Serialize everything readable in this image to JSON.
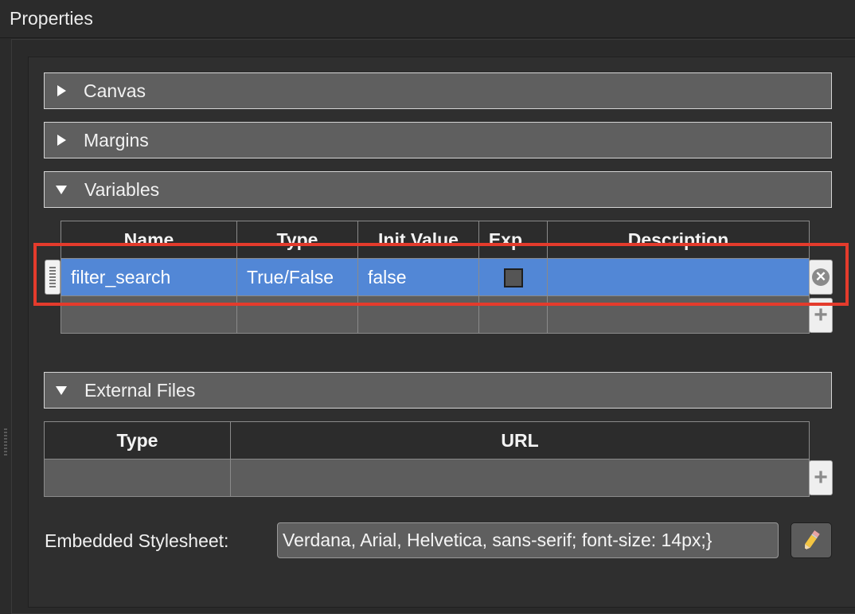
{
  "panel": {
    "title": "Properties"
  },
  "sections": [
    {
      "label": "Canvas",
      "expanded": false
    },
    {
      "label": "Margins",
      "expanded": false
    },
    {
      "label": "Variables",
      "expanded": true
    },
    {
      "label": "External Files",
      "expanded": true
    }
  ],
  "variables": {
    "headers": [
      "Name",
      "Type",
      "Init Value",
      "Exp...",
      "Description"
    ],
    "rows": [
      {
        "name": "filter_search",
        "type": "True/False",
        "init_value": "false",
        "exported": false,
        "description": "",
        "selected": true
      },
      {
        "name": "",
        "type": "",
        "init_value": "",
        "exported": null,
        "description": "",
        "selected": false
      }
    ]
  },
  "external_files": {
    "headers": [
      "Type",
      "URL"
    ],
    "rows": [
      {
        "type": "",
        "url": ""
      }
    ]
  },
  "stylesheet": {
    "label": "Embedded Stylesheet:",
    "value": "Verdana, Arial, Helvetica, sans-serif; font-size: 14px;}"
  },
  "icons": {
    "expand": "triangle-right-icon",
    "collapse": "triangle-down-icon",
    "remove": "remove-row-icon",
    "add": "add-row-icon",
    "edit": "pencil-icon",
    "handle": "drag-handle-icon"
  },
  "colors": {
    "selection": "#5287d6",
    "highlight_box": "#e43b2c",
    "section_bg": "#5f5f5f"
  }
}
